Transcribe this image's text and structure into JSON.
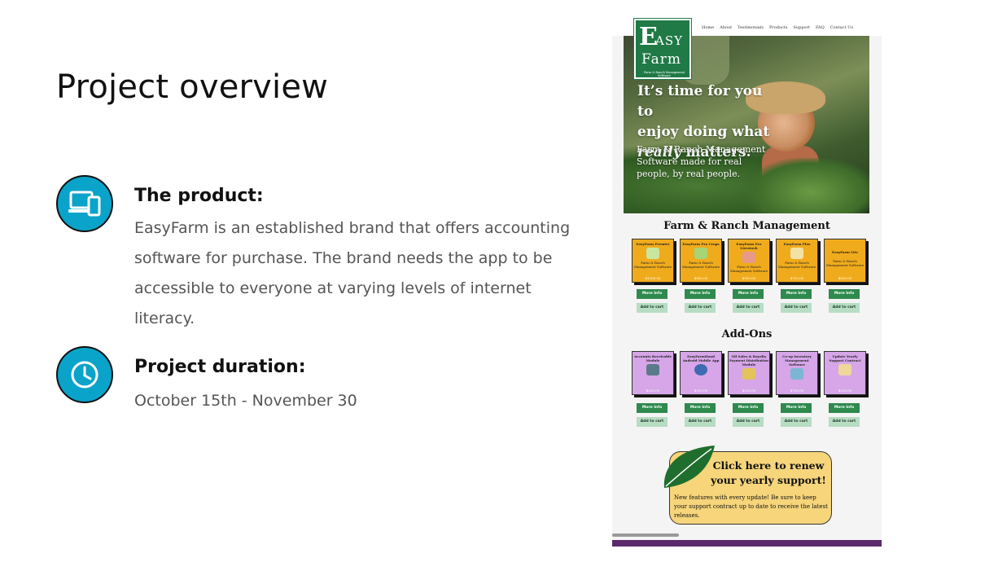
{
  "slide": {
    "title": "Project overview",
    "product_heading": "The product:",
    "product_body": "EasyFarm is an established brand that offers accounting software for purchase. The brand needs the app to be accessible to everyone at varying levels of internet literacy.",
    "duration_heading": "Project duration:",
    "duration_body": "October 15th - November 30"
  },
  "mock": {
    "nav": [
      "Home",
      "About",
      "Testimonials",
      "Products",
      "Support",
      "FAQ",
      "Contact Us"
    ],
    "logo": {
      "e": "E",
      "asy": "ASY",
      "farm": "Farm",
      "tag": "Farm & Ranch Management Software"
    },
    "hero_line1": "It’s time for you to",
    "hero_line2": "enjoy doing what",
    "hero_line3_em": "really",
    "hero_line3_rest": " matters.",
    "hero_sub": "Farm & Ranch Management Software made for real people, by real people.",
    "products_heading": "Farm & Ranch Management",
    "products": [
      {
        "name": "EasyFarm Premier",
        "desc": "Farm & Ranch Management Software",
        "price": "$1200.00"
      },
      {
        "name": "EasyFarm Pro Crops",
        "desc": "Farm & Ranch Management Software",
        "price": "$900.00"
      },
      {
        "name": "EasyFarm Pro Livestock",
        "desc": "Farm & Ranch Management Software",
        "price": "$950.00"
      },
      {
        "name": "EasyFarm Plus",
        "desc": "Farm & Ranch Management Software",
        "price": "$750.00"
      },
      {
        "name": "EasyFarm Lite",
        "desc": "Farm & Ranch Management Software",
        "price": "$600.00"
      }
    ],
    "addons_heading": "Add-Ons",
    "addons": [
      {
        "name": "Accounts Receivable Module",
        "price": "$299.00"
      },
      {
        "name": "EasyFarmHand Android Mobile App",
        "price": "$399.00"
      },
      {
        "name": "Oil Sales & Royalty Payment Distribution Module",
        "price": "$219.00"
      },
      {
        "name": "Co-op Inventory Management Software",
        "price": "$759.00"
      },
      {
        "name": "Update Yearly Support Contract",
        "price": "$229.00"
      }
    ],
    "more_info": "More Info",
    "add_to_cart": "Add to cart",
    "renew_title": "Click here to renew your yearly support!",
    "renew_text": "New features with every update! Be sure to keep your support contract up to date to receive the latest releases."
  },
  "colors": {
    "icon_bg": "#0aa3c9",
    "brand_green": "#1f7a46",
    "product_card": "#f0ab1c",
    "addon_card": "#d6a6e8",
    "renew_bg": "#f6d57b"
  },
  "icons": [
    "devices-icon",
    "clock-icon"
  ]
}
